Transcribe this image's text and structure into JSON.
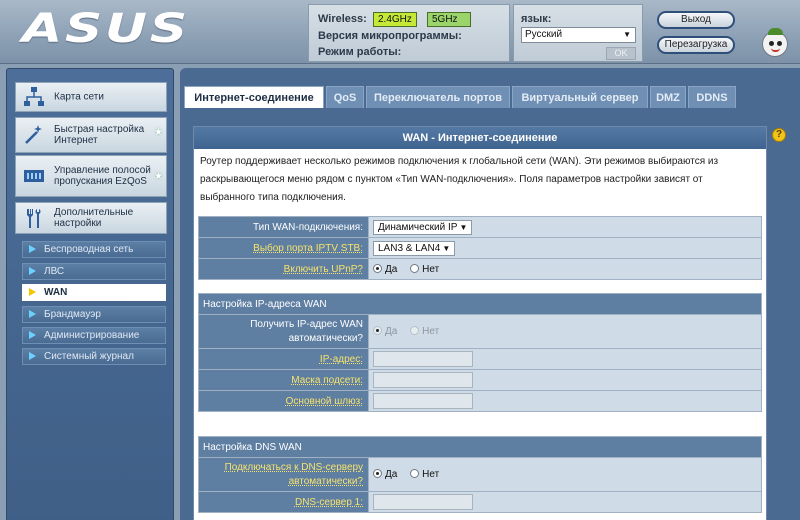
{
  "header": {
    "logo": "ASUS",
    "wireless_label": "Wireless:",
    "band_24": "2.4GHz",
    "band_5": "5GHz",
    "firmware_label": "Версия микропрограммы:",
    "mode_label": "Режим работы:",
    "language_label": "язык:",
    "language_value": "Русский",
    "ok_label": "OK",
    "logout_label": "Выход",
    "reboot_label": "Перезагрузка"
  },
  "sidebar": {
    "main_items": [
      {
        "label": "Карта сети",
        "icon": "network-map-icon"
      },
      {
        "label": "Быстрая настройка Интернет",
        "icon": "wand-icon"
      },
      {
        "label": "Управление полосой пропускания EzQoS",
        "icon": "qos-icon"
      },
      {
        "label": "Дополнительные настройки",
        "icon": "tools-icon"
      }
    ],
    "sub_items": [
      {
        "label": "Беспроводная сеть"
      },
      {
        "label": "ЛВС"
      },
      {
        "label": "WAN"
      },
      {
        "label": "Брандмауэр"
      },
      {
        "label": "Администрирование"
      },
      {
        "label": "Системный журнал"
      }
    ]
  },
  "tabs": [
    {
      "label": "Интернет-соединение"
    },
    {
      "label": "QoS"
    },
    {
      "label": "Переключатель портов"
    },
    {
      "label": "Виртуальный сервер"
    },
    {
      "label": "DMZ"
    },
    {
      "label": "DDNS"
    }
  ],
  "panel": {
    "title": "WAN - Интернет-соединение",
    "description": "Роутер поддерживает несколько режимов подключения к глобальной сети (WAN). Эти режимов выбираются из раскрывающегося меню рядом с пунктом «Тип WAN-подключения». Поля параметров настройки зависят от выбранного типа подключения.",
    "wan_type_label": "Тип WAN-подключения:",
    "wan_type_value": "Динамический IP",
    "iptv_label": "Выбор порта IPTV STB:",
    "iptv_value": "LAN3 & LAN4",
    "upnp_label": "Включить UPnP?",
    "yes": "Да",
    "no": "Нет",
    "ip_section": "Настройка IP-адреса WAN",
    "auto_ip_label": "Получить IP-адрес WAN автоматически?",
    "ip_address_label": "IP-адрес:",
    "subnet_label": "Маска подсети:",
    "gateway_label": "Основной шлюз:",
    "dns_section": "Настройка DNS WAN",
    "auto_dns_label": "Подключаться к DNS-серверу автоматически?",
    "dns1_label": "DNS-сервер 1:"
  },
  "help_icon": "?"
}
